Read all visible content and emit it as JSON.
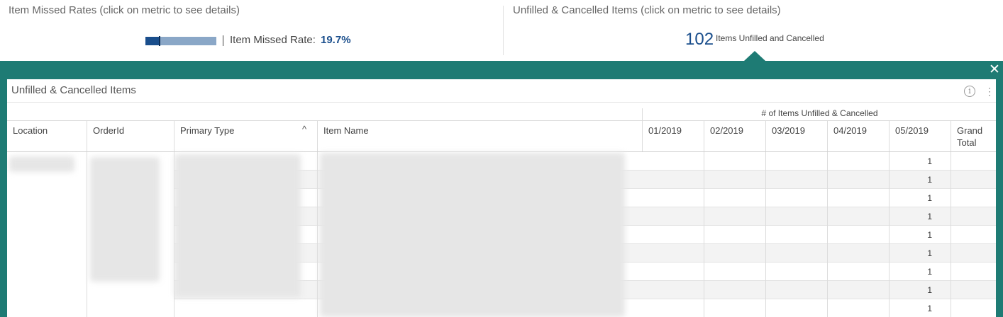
{
  "top": {
    "missed_panel": {
      "title": "Item Missed Rates (click on metric to see details)",
      "metric_label": "Item Missed Rate:",
      "metric_value": "19.7%",
      "bar_fraction": 0.197
    },
    "unfilled_panel": {
      "title": "Unfilled & Cancelled Items (click on metric to see details)",
      "count": "102",
      "caption": "Items Unfilled and Cancelled"
    }
  },
  "detail": {
    "title": "Unfilled & Cancelled Items",
    "info_icon": "info-icon",
    "menu_icon": "kebab-icon",
    "close_icon": "close-icon",
    "group_header": "# of Items Unfilled & Cancelled",
    "columns": [
      "Location",
      "OrderId",
      "Primary Type",
      "Item Name",
      "01/2019",
      "02/2019",
      "03/2019",
      "04/2019",
      "05/2019",
      "Grand Total"
    ],
    "sort_column": "Primary Type",
    "sort_direction": "ascending",
    "rows_may2019": [
      "1",
      "1",
      "1",
      "1",
      "1",
      "1",
      "1",
      "1",
      "1"
    ]
  },
  "colors": {
    "teal_band": "#1e7b74",
    "metric_blue": "#1a4e8c",
    "bar_light": "#8aa7c7"
  }
}
